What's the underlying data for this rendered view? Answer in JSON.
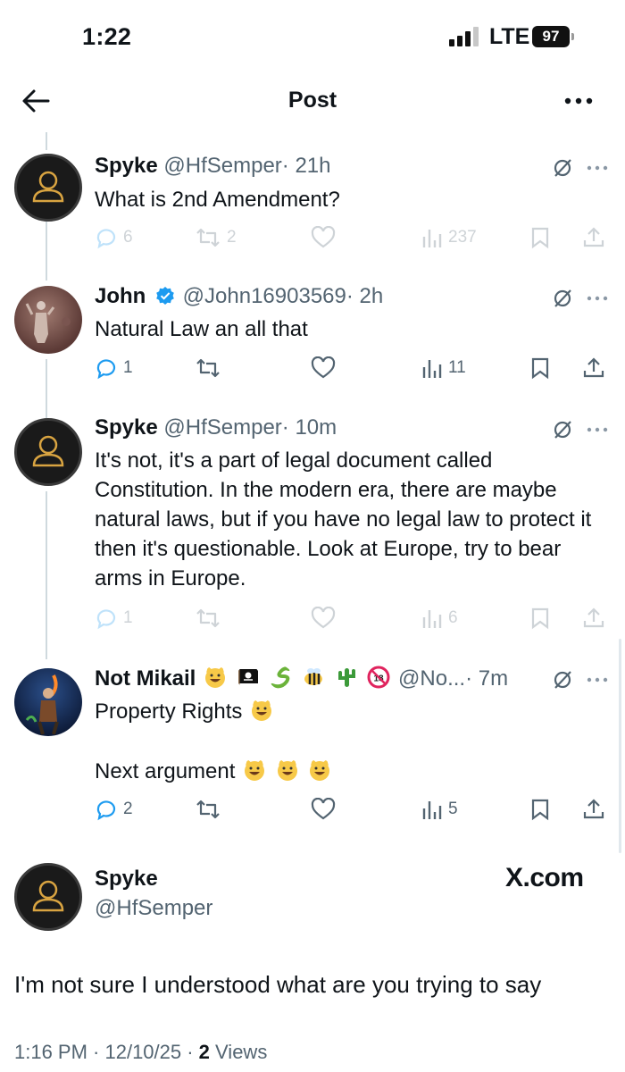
{
  "status_bar": {
    "time": "1:22",
    "network": "LTE",
    "battery": "97"
  },
  "header": {
    "title": "Post"
  },
  "posts": [
    {
      "name": "Spyke",
      "handle": "@HfSemper",
      "time": "· 21h",
      "text": "What is 2nd Amendment?",
      "replies": "6",
      "reposts": "2",
      "likes": "",
      "views": "237"
    },
    {
      "name": "John",
      "handle": "@John16903569",
      "time": "· 2h",
      "text": "Natural Law an all that",
      "replies": "1",
      "reposts": "",
      "likes": "",
      "views": "11"
    },
    {
      "name": "Spyke",
      "handle": "@HfSemper",
      "time": "· 10m",
      "text": "It's not, it's a part of legal document called Constitution. In the modern era, there are maybe natural laws, but if you have no legal law to protect it then it's questionable. Look at Europe, try to bear arms in Europe.",
      "replies": "1",
      "reposts": "",
      "likes": "",
      "views": "6"
    },
    {
      "name": "Not Mikail",
      "handle": "@No...",
      "time": "· 7m",
      "text_line1": "Property Rights",
      "text_line2": "Next argument",
      "replies": "2",
      "reposts": "",
      "likes": "",
      "views": "5"
    }
  ],
  "quoted": {
    "name": "Spyke",
    "handle": "@HfSemper",
    "brand": "X.com",
    "text": "I'm not sure I understood what are you trying to say",
    "timestamp": "1:16 PM · 12/10/25 · ",
    "views_count": "2",
    "views_label": " Views"
  },
  "colors": {
    "text": "#0f1419",
    "secondary": "#536471",
    "verified": "#1d9bf0",
    "thread_line": "#cfd9de"
  }
}
